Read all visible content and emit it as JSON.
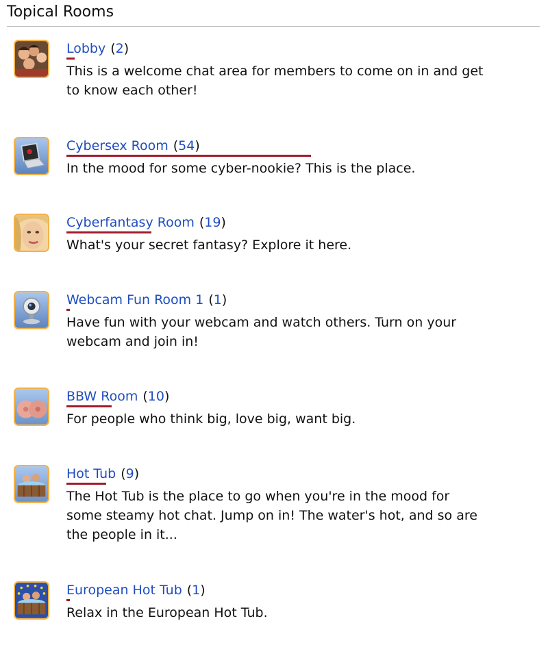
{
  "section": {
    "title": "Topical Rooms"
  },
  "rooms": [
    {
      "name": "Lobby",
      "count": "2",
      "description": "This is a welcome chat area for members to come on in and get to know each other!",
      "icon": "group-photo-icon"
    },
    {
      "name": "Cybersex Room",
      "count": "54",
      "description": "In the mood for some cyber-nookie? This is the place.",
      "icon": "laptop-icon"
    },
    {
      "name": "Cyberfantasy Room",
      "count": "19",
      "description": "What's your secret fantasy? Explore it here.",
      "icon": "face-photo-icon"
    },
    {
      "name": "Webcam Fun Room 1",
      "count": "1",
      "description": "Have fun with your webcam and watch others. Turn on your webcam and join in!",
      "icon": "webcam-icon"
    },
    {
      "name": "BBW Room",
      "count": "10",
      "description": "For people who think big, love big, want big.",
      "icon": "bbw-photo-icon"
    },
    {
      "name": "Hot Tub",
      "count": "9",
      "description": "The Hot Tub is the place to go when you're in the mood for some steamy hot chat. Jump on in! The water's hot, and so are the people in it...",
      "icon": "hot-tub-icon"
    },
    {
      "name": "European Hot Tub",
      "count": "1",
      "description": "Relax in the European Hot Tub.",
      "icon": "european-hot-tub-icon"
    }
  ],
  "colors": {
    "link": "#1f4dbf",
    "text": "#111111",
    "icon_border": "#f2b24a",
    "activity_bar": "#a01c2a"
  }
}
